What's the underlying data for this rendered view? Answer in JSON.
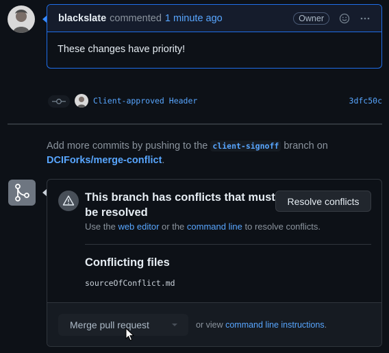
{
  "comment": {
    "author": "blackslate",
    "action": "commented",
    "time": "1 minute ago",
    "badge": "Owner",
    "body": "These changes have priority!",
    "icons": [
      "smiley-icon",
      "kebab-horizontal-icon"
    ]
  },
  "commit": {
    "message": "Client-approved Header",
    "sha": "3dfc50c",
    "icon": "git-commit-icon"
  },
  "push_hint": {
    "prefix": "Add more commits by pushing to the",
    "branch": "client-signoff",
    "middle": "branch on",
    "repo": "DCIForks/merge-conflict",
    "suffix": "."
  },
  "merge_box": {
    "icon": "git-merge-icon",
    "alert_icon": "alert-icon",
    "title": "This branch has conflicts that must be resolved",
    "desc_prefix": "Use the",
    "web_editor": "web editor",
    "desc_middle": "or the",
    "command_line": "command line",
    "desc_suffix": "to resolve conflicts.",
    "resolve_button": "Resolve conflicts",
    "conflicting_heading": "Conflicting files",
    "files": [
      "sourceOfConflict.md"
    ],
    "merge_button": "Merge pull request",
    "alt_prefix": "or view",
    "alt_link": "command line instructions",
    "alt_suffix": "."
  },
  "colors": {
    "background": "#0d1117",
    "accent": "#58a6ff",
    "comment_border": "#1f6feb",
    "muted": "#8b949e"
  }
}
